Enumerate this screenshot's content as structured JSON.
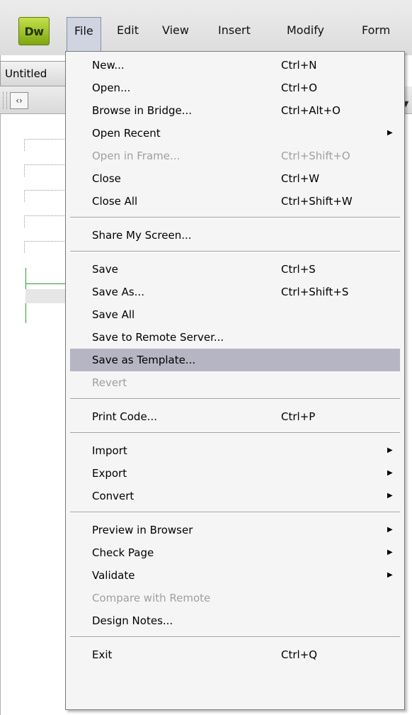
{
  "app": {
    "logo": "Dw"
  },
  "menubar": {
    "items": [
      "File",
      "Edit",
      "View",
      "Insert",
      "Modify",
      "Form"
    ]
  },
  "document": {
    "tab_title": "Untitled"
  },
  "file_menu": {
    "groups": [
      [
        {
          "label": "New...",
          "shortcut": "Ctrl+N",
          "enabled": true
        },
        {
          "label": "Open...",
          "shortcut": "Ctrl+O",
          "enabled": true
        },
        {
          "label": "Browse in Bridge...",
          "shortcut": "Ctrl+Alt+O",
          "enabled": true
        },
        {
          "label": "Open Recent",
          "shortcut": "",
          "enabled": true,
          "submenu": true
        },
        {
          "label": "Open in Frame...",
          "shortcut": "Ctrl+Shift+O",
          "enabled": false
        },
        {
          "label": "Close",
          "shortcut": "Ctrl+W",
          "enabled": true
        },
        {
          "label": "Close All",
          "shortcut": "Ctrl+Shift+W",
          "enabled": true
        }
      ],
      [
        {
          "label": "Share My Screen...",
          "shortcut": "",
          "enabled": true
        }
      ],
      [
        {
          "label": "Save",
          "shortcut": "Ctrl+S",
          "enabled": true
        },
        {
          "label": "Save As...",
          "shortcut": "Ctrl+Shift+S",
          "enabled": true
        },
        {
          "label": "Save All",
          "shortcut": "",
          "enabled": true
        },
        {
          "label": "Save to Remote Server...",
          "shortcut": "",
          "enabled": true
        },
        {
          "label": "Save as Template...",
          "shortcut": "",
          "enabled": true,
          "highlighted": true
        },
        {
          "label": "Revert",
          "shortcut": "",
          "enabled": false
        }
      ],
      [
        {
          "label": "Print Code...",
          "shortcut": "Ctrl+P",
          "enabled": true
        }
      ],
      [
        {
          "label": "Import",
          "shortcut": "",
          "enabled": true,
          "submenu": true
        },
        {
          "label": "Export",
          "shortcut": "",
          "enabled": true,
          "submenu": true
        },
        {
          "label": "Convert",
          "shortcut": "",
          "enabled": true,
          "submenu": true
        }
      ],
      [
        {
          "label": "Preview in Browser",
          "shortcut": "",
          "enabled": true,
          "submenu": true
        },
        {
          "label": "Check Page",
          "shortcut": "",
          "enabled": true,
          "submenu": true
        },
        {
          "label": "Validate",
          "shortcut": "",
          "enabled": true,
          "submenu": true
        },
        {
          "label": "Compare with Remote",
          "shortcut": "",
          "enabled": false
        },
        {
          "label": "Design Notes...",
          "shortcut": "",
          "enabled": true
        }
      ],
      [
        {
          "label": "Exit",
          "shortcut": "Ctrl+Q",
          "enabled": true
        }
      ]
    ]
  },
  "colors": {
    "highlight": "#b5b5c4",
    "disabled_text": "#9f9f9f",
    "logo_green": "#8cb51a"
  }
}
